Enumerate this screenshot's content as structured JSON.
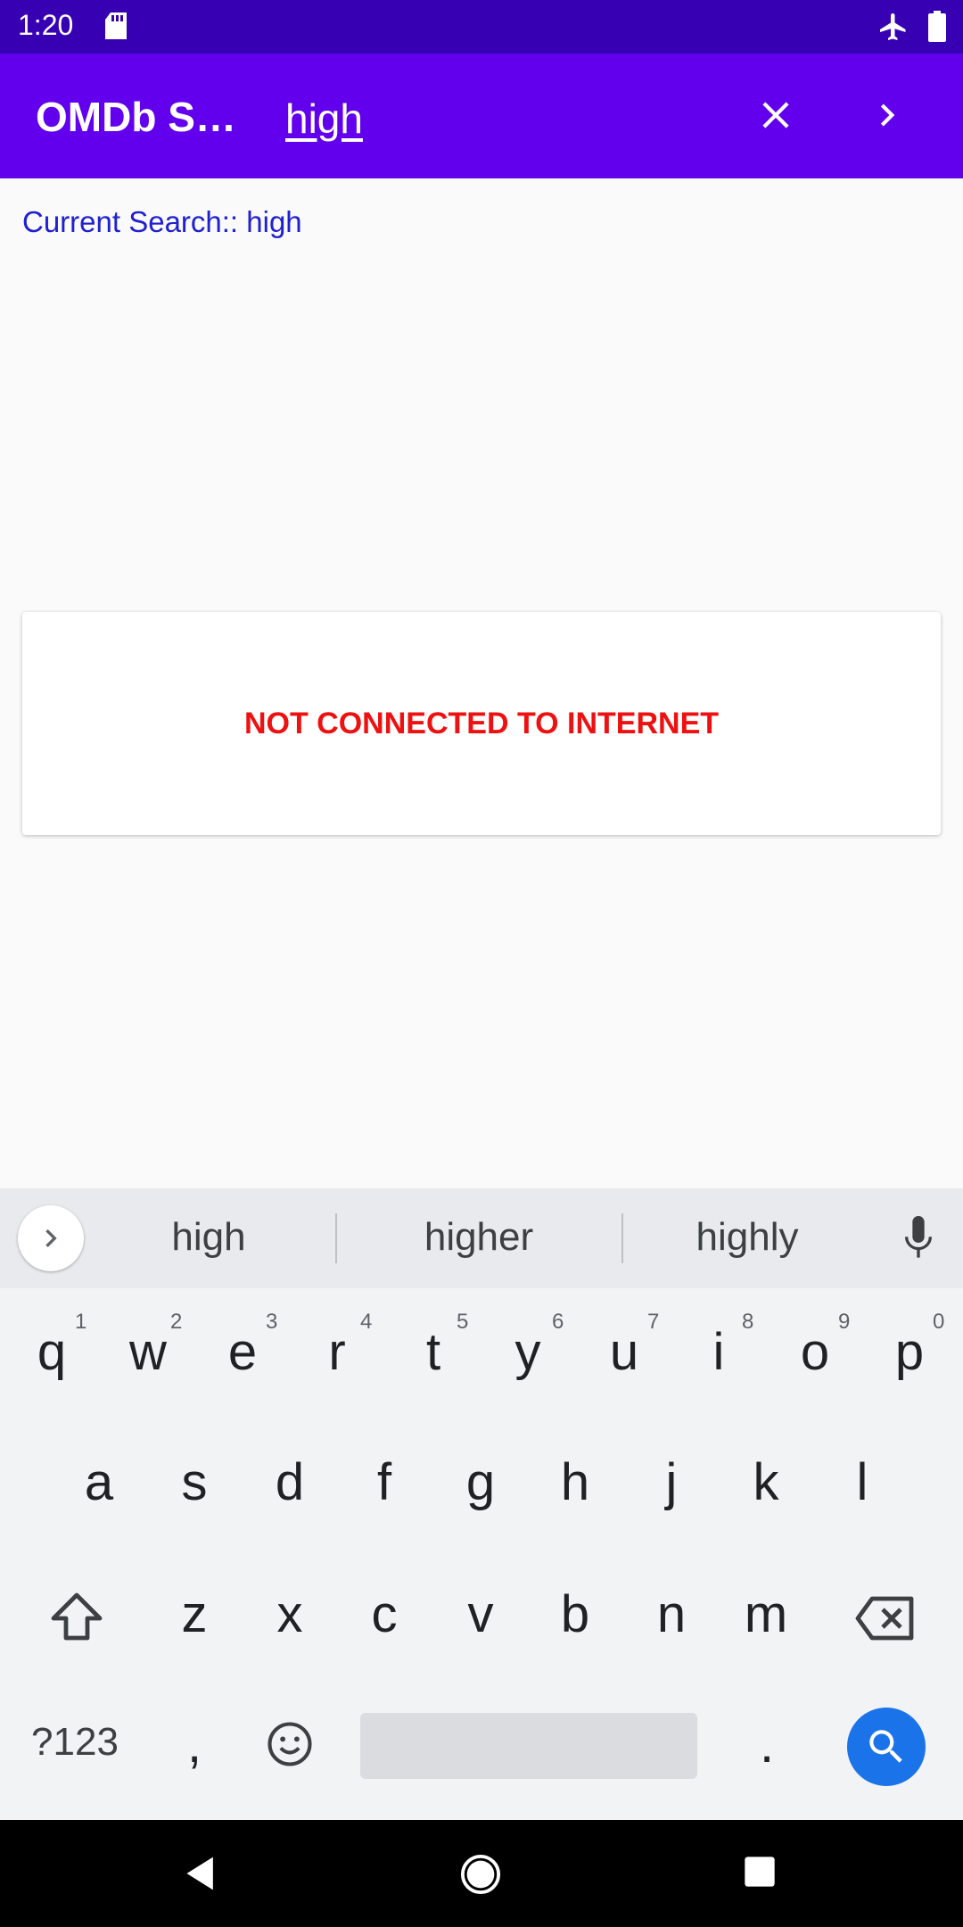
{
  "status_bar": {
    "time": "1:20"
  },
  "app_bar": {
    "title": "OMDb S…",
    "search_query": "high"
  },
  "current_search_label": "Current Search:: high",
  "message_card": {
    "text": "NOT CONNECTED TO INTERNET"
  },
  "keyboard": {
    "suggestions": [
      "high",
      "higher",
      "highly"
    ],
    "row1": [
      "q",
      "w",
      "e",
      "r",
      "t",
      "y",
      "u",
      "i",
      "o",
      "p"
    ],
    "row1_hints": [
      "1",
      "2",
      "3",
      "4",
      "5",
      "6",
      "7",
      "8",
      "9",
      "0"
    ],
    "row2": [
      "a",
      "s",
      "d",
      "f",
      "g",
      "h",
      "j",
      "k",
      "l"
    ],
    "row3": [
      "z",
      "x",
      "c",
      "v",
      "b",
      "n",
      "m"
    ],
    "symbols_key": "?123",
    "comma_key": ",",
    "period_key": "."
  },
  "colors": {
    "status_bar": "#3700b3",
    "app_bar": "#6200ee",
    "current_search_text": "#2020d0",
    "error_text": "#ee1111",
    "search_key": "#1a73e8"
  }
}
